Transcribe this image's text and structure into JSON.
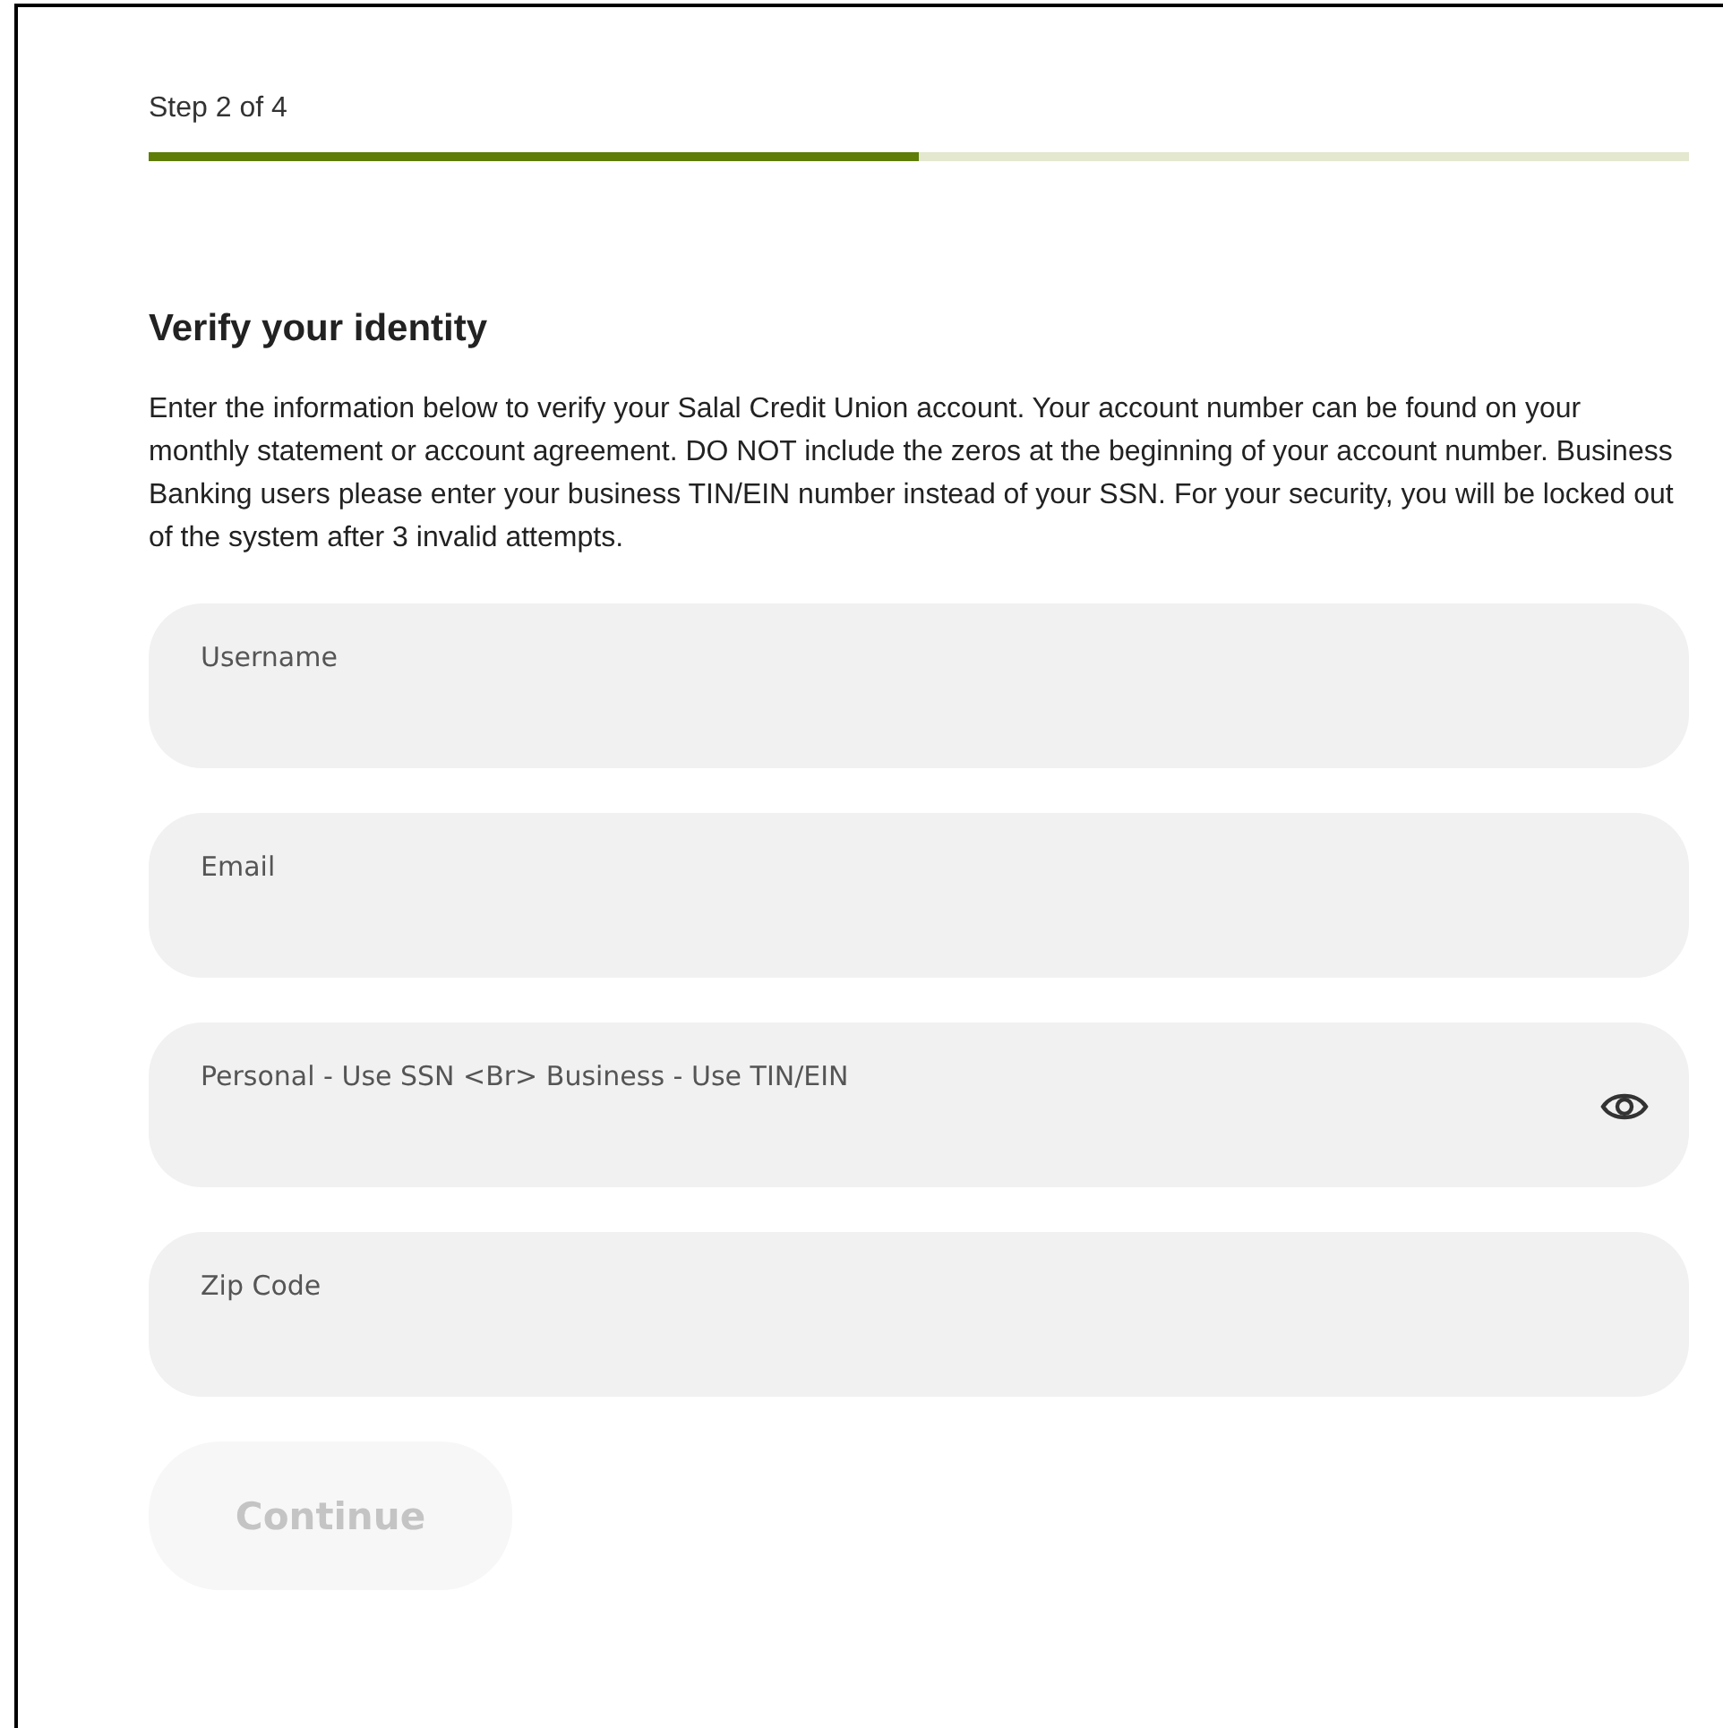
{
  "progress": {
    "label": "Step 2 of 4",
    "level": 0.5
  },
  "heading": "Verify your identity",
  "intro": "Enter the information below to verify your Salal Credit Union account. Your account number can be found on your monthly statement or account agreement. DO NOT include the zeros at the beginning of your account number. Business Banking users please enter your business TIN/EIN number instead of your SSN. For your security, you will be locked out of the system after 3 invalid attempts.",
  "fields": [
    {
      "placeholder": "Username",
      "kind": "text"
    },
    {
      "placeholder": "Email",
      "kind": "text"
    },
    {
      "placeholder": "Personal - Use SSN <Br> Business - Use TIN/EIN",
      "kind": "secret"
    },
    {
      "placeholder": "Zip Code",
      "kind": "text"
    }
  ],
  "continue_button": {
    "label": "Continue",
    "disabled": true
  }
}
